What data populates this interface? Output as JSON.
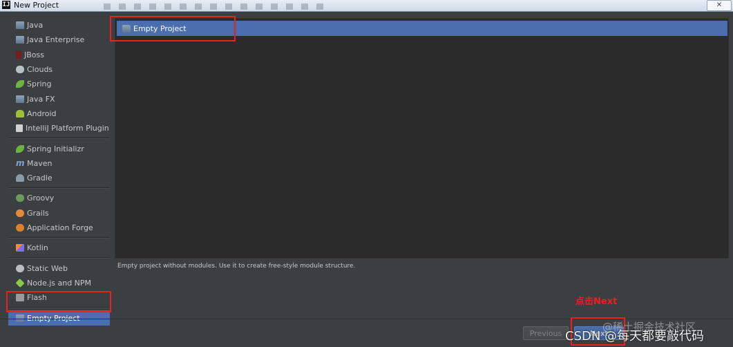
{
  "window": {
    "title": "New Project",
    "app_icon": "intellij-icon",
    "close_glyph": "✕"
  },
  "sidebar": {
    "groups": [
      [
        {
          "label": "Java",
          "icon": "folder-icon"
        },
        {
          "label": "Java Enterprise",
          "icon": "java-enterprise-icon"
        },
        {
          "label": "JBoss",
          "icon": "jboss-icon"
        },
        {
          "label": "Clouds",
          "icon": "cloud-icon"
        },
        {
          "label": "Spring",
          "icon": "spring-leaf-icon"
        },
        {
          "label": "Java FX",
          "icon": "folder-icon"
        },
        {
          "label": "Android",
          "icon": "android-icon"
        },
        {
          "label": "IntelliJ Platform Plugin",
          "icon": "intellij-plugin-icon"
        }
      ],
      [
        {
          "label": "Spring Initializr",
          "icon": "spring-initializr-icon"
        },
        {
          "label": "Maven",
          "icon": "maven-icon"
        },
        {
          "label": "Gradle",
          "icon": "gradle-icon"
        }
      ],
      [
        {
          "label": "Groovy",
          "icon": "groovy-icon"
        },
        {
          "label": "Grails",
          "icon": "grails-icon"
        },
        {
          "label": "Application Forge",
          "icon": "application-forge-icon"
        }
      ],
      [
        {
          "label": "Kotlin",
          "icon": "kotlin-icon"
        }
      ],
      [
        {
          "label": "Static Web",
          "icon": "static-web-icon"
        },
        {
          "label": "Node.js and NPM",
          "icon": "nodejs-icon"
        },
        {
          "label": "Flash",
          "icon": "flash-icon"
        }
      ],
      [
        {
          "label": "Empty Project",
          "icon": "folder-icon",
          "selected": true
        }
      ]
    ]
  },
  "main": {
    "selected_item": "Empty Project",
    "description": "Empty project without modules. Use it to create free-style module structure."
  },
  "buttons": {
    "previous": "Previous",
    "next": "Next"
  },
  "annotation": {
    "text": "点击Next",
    "color": "#e8221f"
  },
  "watermarks": {
    "line1": "@稀土掘金技术社区",
    "line2": "CSDN @每天都要敲代码"
  },
  "colors": {
    "selection": "#4b6eaf",
    "panel": "#3c3f41",
    "content": "#2b2b2b"
  }
}
